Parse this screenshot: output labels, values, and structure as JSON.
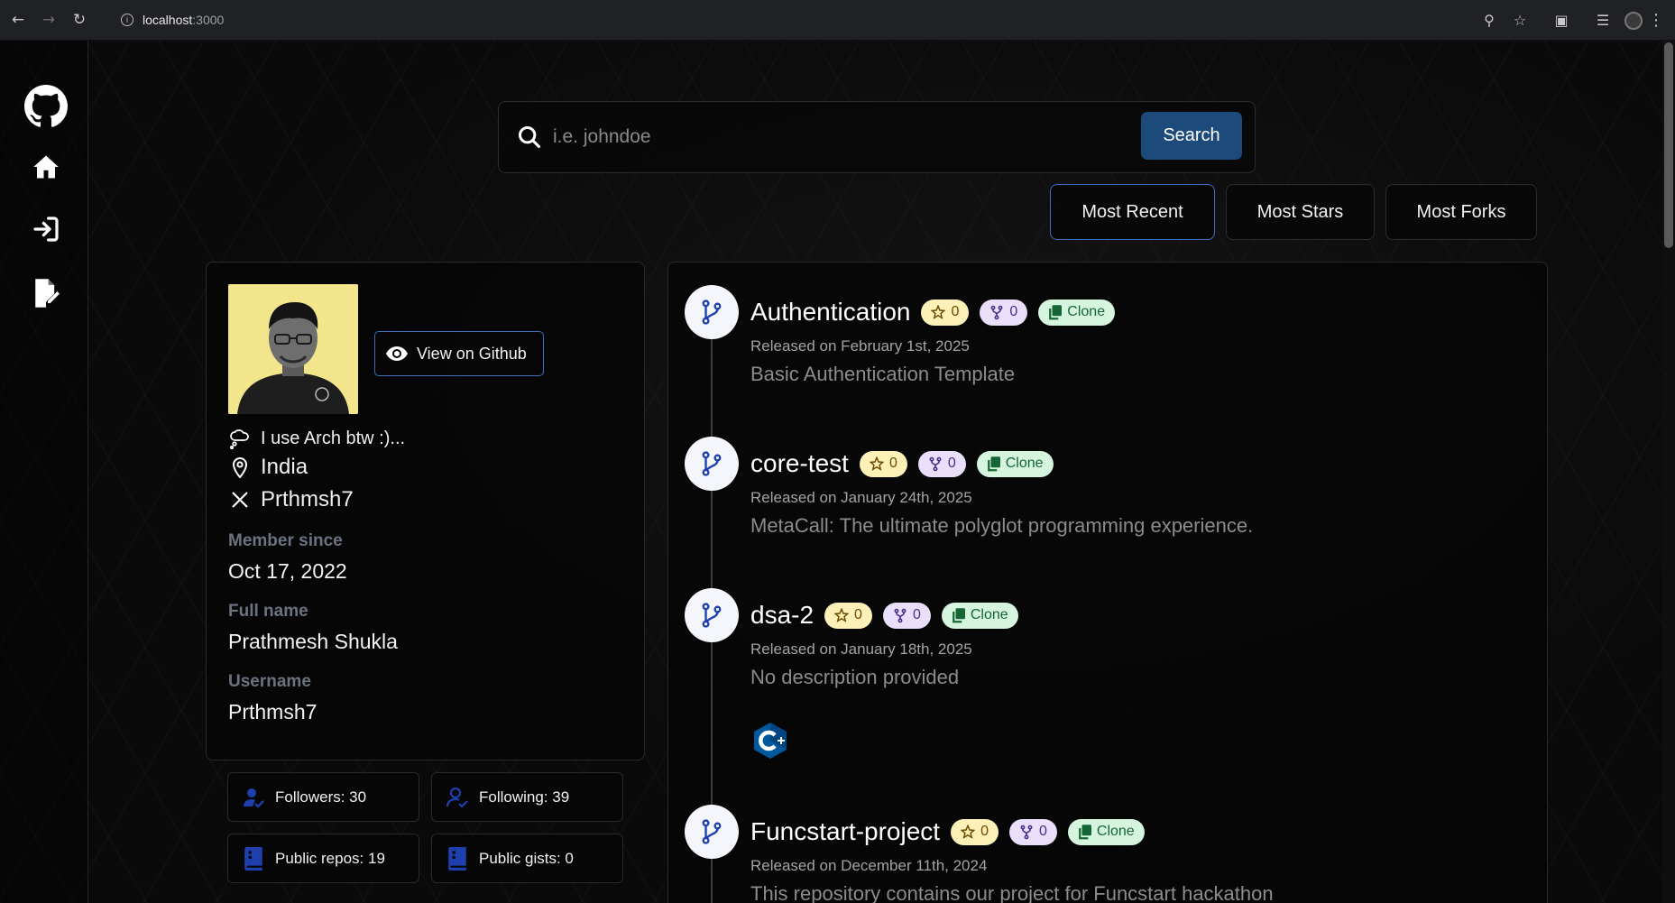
{
  "browser": {
    "url_host": "localhost",
    "url_port": ":3000"
  },
  "sidebar": {
    "items": [
      {
        "icon": "github-icon"
      },
      {
        "icon": "home-icon"
      },
      {
        "icon": "login-icon"
      },
      {
        "icon": "signup-icon"
      }
    ]
  },
  "search": {
    "placeholder": "i.e. johndoe",
    "button_label": "Search"
  },
  "sort": {
    "options": [
      "Most Recent",
      "Most Stars",
      "Most Forks"
    ],
    "selected": "Most Recent"
  },
  "profile": {
    "view_button": "View on Github",
    "bio": "I use Arch btw :)...",
    "location": "India",
    "twitter": "Prthmsh7",
    "member_since_label": "Member since",
    "member_since": "Oct 17, 2022",
    "full_name_label": "Full name",
    "full_name": "Prathmesh Shukla",
    "username_label": "Username",
    "username": "Prthmsh7"
  },
  "stats": {
    "followers": "Followers: 30",
    "following": "Following: 39",
    "public_repos": "Public repos: 19",
    "public_gists": "Public gists: 0"
  },
  "repos": [
    {
      "name": "Authentication",
      "stars": "0",
      "forks": "0",
      "clone_label": "Clone",
      "released": "Released on February 1st, 2025",
      "description": "Basic Authentication Template"
    },
    {
      "name": "core-test",
      "stars": "0",
      "forks": "0",
      "clone_label": "Clone",
      "released": "Released on January 24th, 2025",
      "description": "MetaCall: The ultimate polyglot programming experience."
    },
    {
      "name": "dsa-2",
      "stars": "0",
      "forks": "0",
      "clone_label": "Clone",
      "released": "Released on January 18th, 2025",
      "description": "No description provided",
      "language_icon": "cpp-icon"
    },
    {
      "name": "Funcstart-project",
      "stars": "0",
      "forks": "0",
      "clone_label": "Clone",
      "released": "Released on December 11th, 2024",
      "description": "This repository contains our project for Funcstart hackathon"
    }
  ],
  "colors": {
    "accent": "#1c4a7b",
    "star_pill": "#fdf1b7",
    "fork_pill": "#eadffb",
    "clone_pill": "#d6f5df"
  }
}
